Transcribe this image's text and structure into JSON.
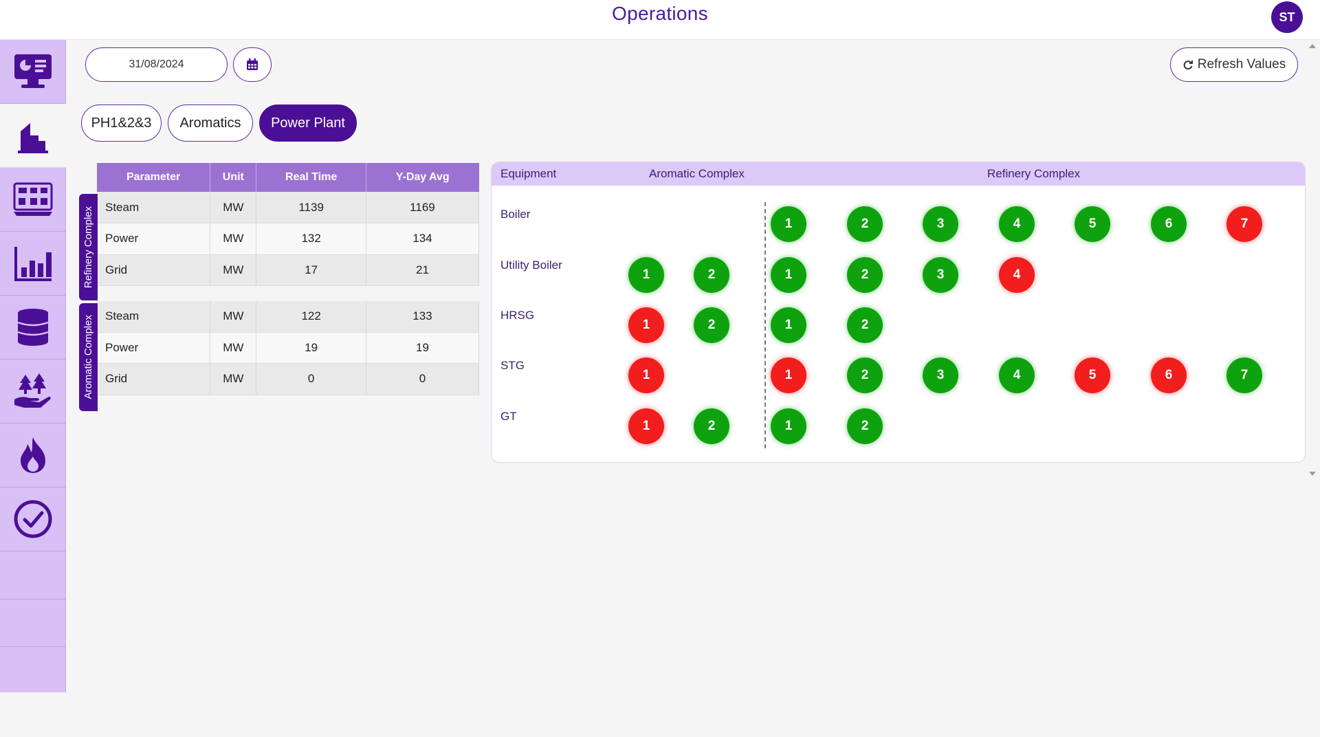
{
  "header": {
    "title": "Operations",
    "avatar_initials": "ST"
  },
  "sidebar": {
    "items": [
      {
        "icon": "monitor-dashboard-icon"
      },
      {
        "icon": "refinery-building-icon"
      },
      {
        "icon": "process-diagram-icon"
      },
      {
        "icon": "bar-chart-icon"
      },
      {
        "icon": "oil-barrel-icon"
      },
      {
        "icon": "environment-hand-icon"
      },
      {
        "icon": "flame-icon"
      },
      {
        "icon": "check-circle-icon"
      }
    ]
  },
  "controls": {
    "date": "31/08/2024",
    "refresh_label": "Refresh Values"
  },
  "tabs": [
    {
      "label": "PH1&2&3",
      "active": false
    },
    {
      "label": "Aromatics",
      "active": false
    },
    {
      "label": "Power Plant",
      "active": true
    }
  ],
  "params_table": {
    "headers": [
      "Parameter",
      "Unit",
      "Real Time",
      "Y-Day Avg"
    ],
    "groups": [
      {
        "label": "Refinery Complex",
        "rows": [
          [
            "Steam",
            "MW",
            "1139",
            "1169"
          ],
          [
            "Power",
            "MW",
            "132",
            "134"
          ],
          [
            "Grid",
            "MW",
            "17",
            "21"
          ]
        ]
      },
      {
        "label": "Aromatic Complex",
        "rows": [
          [
            "Steam",
            "MW",
            "122",
            "133"
          ],
          [
            "Power",
            "MW",
            "19",
            "19"
          ],
          [
            "Grid",
            "MW",
            "0",
            "0"
          ]
        ]
      }
    ]
  },
  "equipment": {
    "headers": {
      "equipment": "Equipment",
      "aromatic": "Aromatic Complex",
      "refinery": "Refinery Complex"
    },
    "colors": {
      "green": "#0ea30e",
      "red": "#f21d1d"
    },
    "rows": [
      {
        "name": "Boiler",
        "aromatic": [],
        "refinery": [
          {
            "n": "1",
            "status": "green"
          },
          {
            "n": "2",
            "status": "green"
          },
          {
            "n": "3",
            "status": "green"
          },
          {
            "n": "4",
            "status": "green"
          },
          {
            "n": "5",
            "status": "green"
          },
          {
            "n": "6",
            "status": "green"
          },
          {
            "n": "7",
            "status": "red"
          }
        ]
      },
      {
        "name": "Utility Boiler",
        "aromatic": [
          {
            "n": "1",
            "status": "green"
          },
          {
            "n": "2",
            "status": "green"
          }
        ],
        "refinery": [
          {
            "n": "1",
            "status": "green"
          },
          {
            "n": "2",
            "status": "green"
          },
          {
            "n": "3",
            "status": "green"
          },
          {
            "n": "4",
            "status": "red"
          }
        ]
      },
      {
        "name": "HRSG",
        "aromatic": [
          {
            "n": "1",
            "status": "red"
          },
          {
            "n": "2",
            "status": "green"
          }
        ],
        "refinery": [
          {
            "n": "1",
            "status": "green"
          },
          {
            "n": "2",
            "status": "green"
          }
        ]
      },
      {
        "name": "STG",
        "aromatic": [
          {
            "n": "1",
            "status": "red"
          }
        ],
        "refinery": [
          {
            "n": "1",
            "status": "red"
          },
          {
            "n": "2",
            "status": "green"
          },
          {
            "n": "3",
            "status": "green"
          },
          {
            "n": "4",
            "status": "green"
          },
          {
            "n": "5",
            "status": "red"
          },
          {
            "n": "6",
            "status": "red"
          },
          {
            "n": "7",
            "status": "green"
          }
        ]
      },
      {
        "name": "GT",
        "aromatic": [
          {
            "n": "1",
            "status": "red"
          },
          {
            "n": "2",
            "status": "green"
          }
        ],
        "refinery": [
          {
            "n": "1",
            "status": "green"
          },
          {
            "n": "2",
            "status": "green"
          }
        ]
      }
    ]
  }
}
